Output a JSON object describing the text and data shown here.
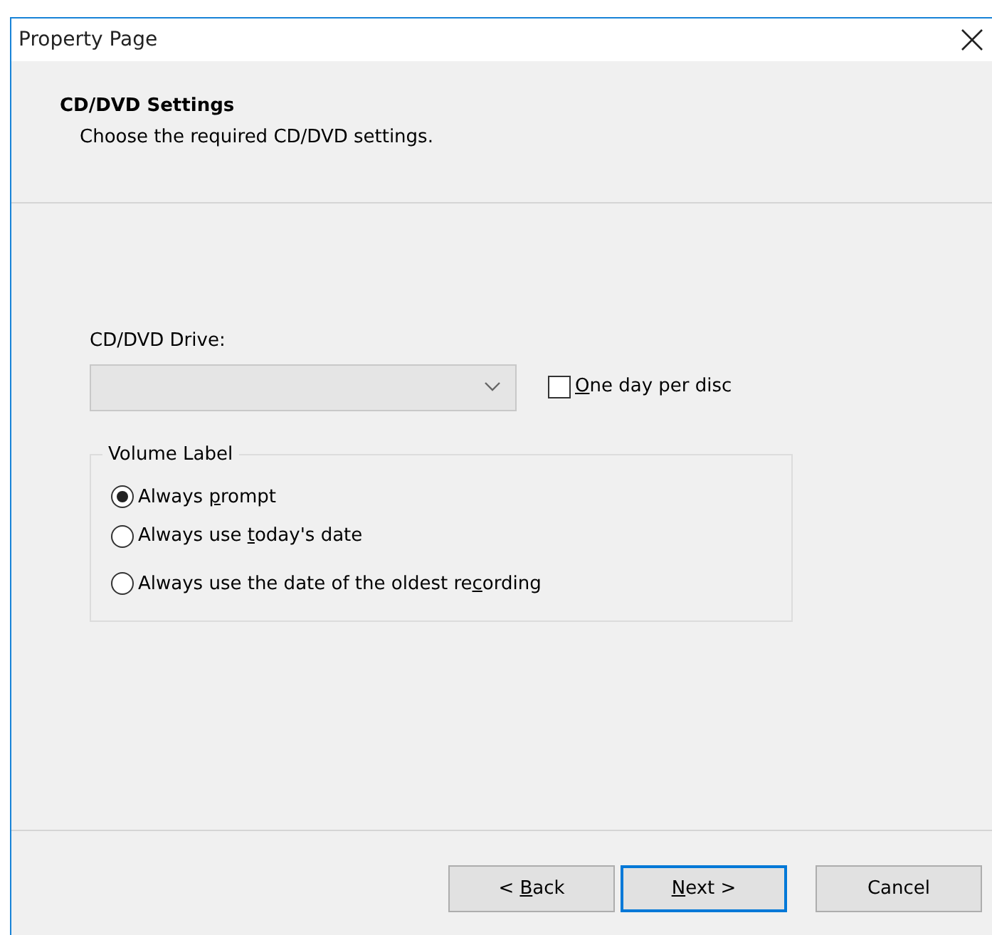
{
  "window": {
    "title": "Property Page"
  },
  "header": {
    "title": "CD/DVD Settings",
    "subtitle": "Choose the required CD/DVD settings."
  },
  "drive": {
    "label": "CD/DVD Drive:",
    "value_disabled": true
  },
  "one_day_per_disc": {
    "label_key": "O",
    "label_after": "ne day per disc",
    "checked": false
  },
  "volume_label": {
    "title": "Volume Label",
    "options": [
      {
        "label_before": "Always ",
        "label_key": "p",
        "label_after": "rompt",
        "selected": true
      },
      {
        "label_before": "Always use ",
        "label_key": "t",
        "label_after": "oday's date",
        "selected": false
      },
      {
        "label_before": "Always use the date of the oldest re",
        "label_key": "c",
        "label_after": "ording",
        "selected": false
      }
    ]
  },
  "buttons": [
    {
      "label_before": "< ",
      "label_key": "B",
      "label_after": "ack",
      "focused": false
    },
    {
      "label_key": "N",
      "label_after": "ext >",
      "focused": true
    },
    {
      "label_after": "Cancel",
      "focused": false
    }
  ]
}
